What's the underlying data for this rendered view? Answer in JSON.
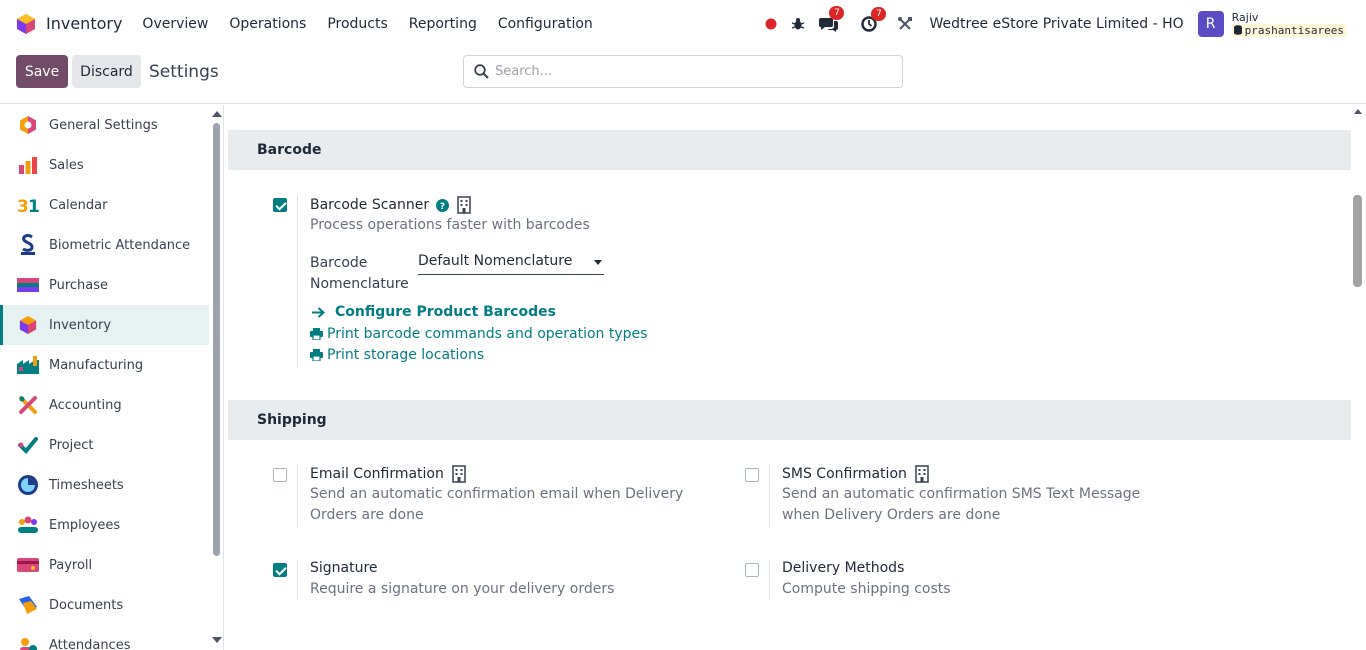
{
  "navbar": {
    "app_name": "Inventory",
    "menu": [
      "Overview",
      "Operations",
      "Products",
      "Reporting",
      "Configuration"
    ],
    "messages_count": "7",
    "activities_count": "7",
    "company": "Wedtree eStore Private Limited - HO",
    "user_initial": "R",
    "user_name": "Rajiv",
    "database": "prashantisarees",
    "colors": {
      "brand": "#714b67",
      "accent": "#017e84",
      "badge": "#dc2626"
    }
  },
  "control": {
    "save_label": "Save",
    "discard_label": "Discard",
    "breadcrumb": "Settings",
    "search_placeholder": "Search..."
  },
  "sidebar": {
    "items": [
      {
        "label": "General Settings",
        "icon": "general-settings-icon"
      },
      {
        "label": "Sales",
        "icon": "sales-icon"
      },
      {
        "label": "Calendar",
        "icon": "calendar-icon"
      },
      {
        "label": "Biometric Attendance",
        "icon": "biometric-attendance-icon"
      },
      {
        "label": "Purchase",
        "icon": "purchase-icon"
      },
      {
        "label": "Inventory",
        "icon": "inventory-icon",
        "active": true
      },
      {
        "label": "Manufacturing",
        "icon": "manufacturing-icon"
      },
      {
        "label": "Accounting",
        "icon": "accounting-icon"
      },
      {
        "label": "Project",
        "icon": "project-icon"
      },
      {
        "label": "Timesheets",
        "icon": "timesheets-icon"
      },
      {
        "label": "Employees",
        "icon": "employees-icon"
      },
      {
        "label": "Payroll",
        "icon": "payroll-icon"
      },
      {
        "label": "Documents",
        "icon": "documents-icon"
      },
      {
        "label": "Attendances",
        "icon": "attendances-icon"
      }
    ]
  },
  "barcode": {
    "heading": "Barcode",
    "scanner": {
      "title": "Barcode Scanner",
      "description": "Process operations faster with barcodes",
      "checked": true,
      "nomenclature_label": "Barcode Nomenclature",
      "nomenclature_value": "Default Nomenclature",
      "configure_link": "Configure Product Barcodes",
      "print_commands_link": "Print barcode commands and operation types",
      "print_locations_link": "Print storage locations"
    }
  },
  "shipping": {
    "heading": "Shipping",
    "email": {
      "title": "Email Confirmation",
      "description": "Send an automatic confirmation email when Delivery Orders are done",
      "checked": false
    },
    "sms": {
      "title": "SMS Confirmation",
      "description": "Send an automatic confirmation SMS Text Message when Delivery Orders are done",
      "checked": false
    },
    "signature": {
      "title": "Signature",
      "description": "Require a signature on your delivery orders",
      "checked": true
    },
    "delivery_methods": {
      "title": "Delivery Methods",
      "description": "Compute shipping costs",
      "checked": false
    }
  }
}
